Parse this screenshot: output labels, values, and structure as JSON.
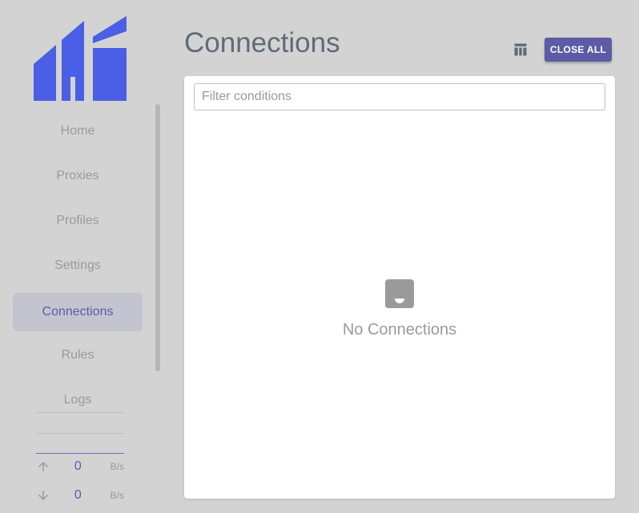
{
  "sidebar": {
    "brand": "hi",
    "nav": [
      {
        "label": "Home",
        "active": false
      },
      {
        "label": "Proxies",
        "active": false
      },
      {
        "label": "Profiles",
        "active": false
      },
      {
        "label": "Settings",
        "active": false
      },
      {
        "label": "Connections",
        "active": true
      },
      {
        "label": "Rules",
        "active": false
      },
      {
        "label": "Logs",
        "active": false
      }
    ],
    "traffic": {
      "upload": {
        "value": "0",
        "unit": "B/s",
        "icon": "arrow-up-icon"
      },
      "download": {
        "value": "0",
        "unit": "B/s",
        "icon": "arrow-down-icon"
      }
    }
  },
  "header": {
    "title": "Connections",
    "table_icon": "table-columns-icon",
    "close_all_label": "CLOSE ALL"
  },
  "filter": {
    "placeholder": "Filter conditions",
    "value": ""
  },
  "empty_state": {
    "icon": "inbox-icon",
    "text": "No Connections"
  },
  "colors": {
    "background": "#d3d3d3",
    "accent": "#5d5ba5",
    "logo": "#4a5fe6",
    "active_nav_bg": "#c4c4d0",
    "card": "#ffffff"
  }
}
